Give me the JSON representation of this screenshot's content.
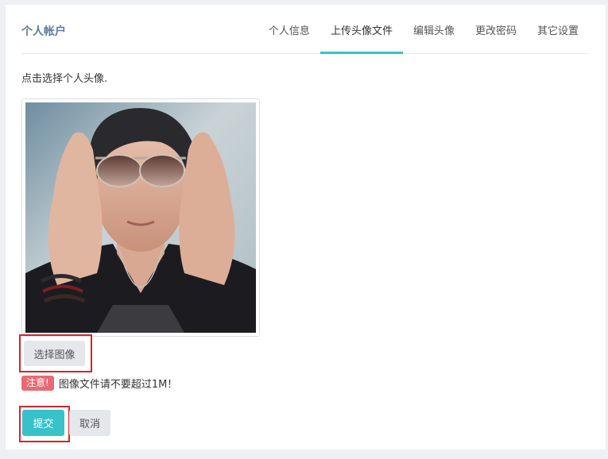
{
  "header": {
    "title": "个人帐户",
    "tabs": [
      {
        "label": "个人信息",
        "active": false
      },
      {
        "label": "上传头像文件",
        "active": true
      },
      {
        "label": "编辑头像",
        "active": false
      },
      {
        "label": "更改密码",
        "active": false
      },
      {
        "label": "其它设置",
        "active": false
      }
    ]
  },
  "main": {
    "hint": "点击选择个人头像.",
    "select_button": "选择图像",
    "notice_badge": "注意!",
    "notice_text": "图像文件请不要超过1M！",
    "submit_button": "提交",
    "cancel_button": "取消"
  },
  "colors": {
    "accent": "#37c2ca",
    "notice": "#e86a75",
    "highlight_frame": "#d3242b",
    "title": "#5f7b9b"
  }
}
